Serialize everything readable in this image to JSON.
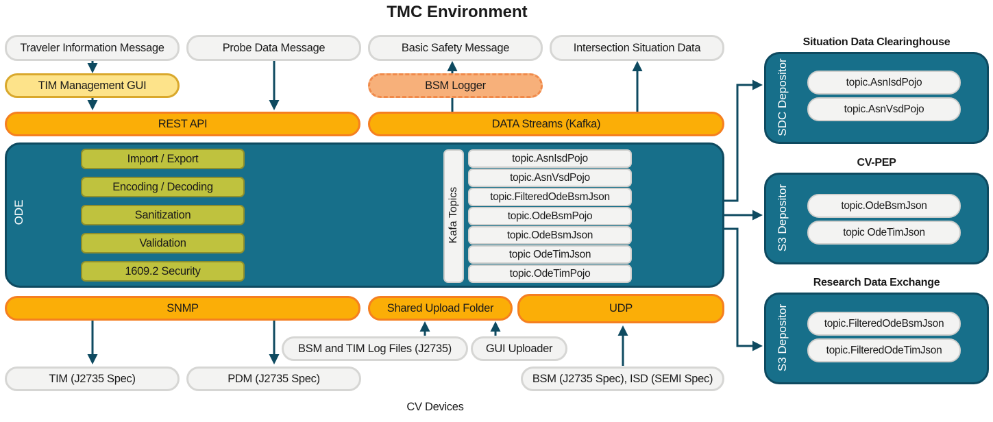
{
  "title": "TMC Environment",
  "footer": "CV Devices",
  "colors": {
    "teal": "#176f8a",
    "arrow": "#0e4a60",
    "orange": "#fbae07",
    "orange_border": "#f57f20",
    "olive": "#bfc23e",
    "yellow": "#fde38a",
    "grey": "#f3f3f2"
  },
  "tmc_messages": [
    "Traveler Information Message",
    "Probe Data Message",
    "Basic Safety Message",
    "Intersection Situation Data"
  ],
  "tim_gui": "TIM Management GUI",
  "bsm_logger": "BSM Logger",
  "rest_api": "REST API",
  "data_streams": "DATA Streams (Kafka)",
  "ode": {
    "label": "ODE",
    "functions": [
      "Import / Export",
      "Encoding / Decoding",
      "Sanitization",
      "Validation",
      "1609.2 Security"
    ],
    "topics_label": "Kafa Topics",
    "topics": [
      "topic.AsnIsdPojo",
      "topic.AsnVsdPojo",
      "topic.FilteredOdeBsmJson",
      "topic.OdeBsmPojo",
      "topic.OdeBsmJson",
      "topic OdeTimJson",
      "topic.OdeTimPojo"
    ]
  },
  "interfaces": {
    "snmp": "SNMP",
    "shared_upload": "Shared Upload Folder",
    "udp": "UDP"
  },
  "uploads": {
    "log_files": "BSM and TIM Log Files (J2735)",
    "gui_uploader": "GUI Uploader"
  },
  "cv_devices": [
    "TIM (J2735 Spec)",
    "PDM (J2735 Spec)",
    "BSM (J2735 Spec), ISD (SEMI Spec)"
  ],
  "destinations": [
    {
      "title": "Situation Data Clearinghouse",
      "depositor": "SDC Depositor",
      "topics": [
        "topic.AsnIsdPojo",
        "topic.AsnVsdPojo"
      ]
    },
    {
      "title": "CV-PEP",
      "depositor": "S3 Depositor",
      "topics": [
        "topic.OdeBsmJson",
        "topic OdeTimJson"
      ]
    },
    {
      "title": "Research Data Exchange",
      "depositor": "S3 Depositor",
      "topics": [
        "topic.FilteredOdeBsmJson",
        "topic.FilteredOdeTimJson"
      ]
    }
  ]
}
